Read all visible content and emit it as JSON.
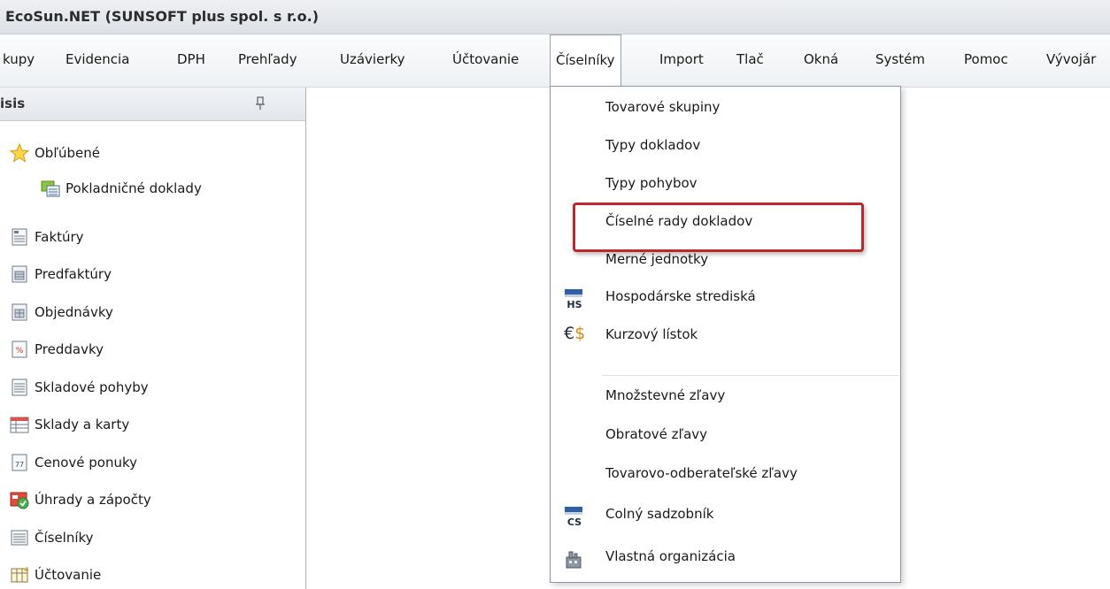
{
  "window": {
    "title": "EcoSun.NET  (SUNSOFT plus spol. s r.o.)"
  },
  "menubar": {
    "items": [
      {
        "label": "kupy",
        "active": false
      },
      {
        "label": "Evidencia",
        "active": false
      },
      {
        "label": "DPH",
        "active": false
      },
      {
        "label": "Prehľady",
        "active": false
      },
      {
        "label": "Uzávierky",
        "active": false
      },
      {
        "label": "Účtovanie",
        "active": false
      },
      {
        "label": "Číselníky",
        "active": true
      },
      {
        "label": "Import",
        "active": false
      },
      {
        "label": "Tlač",
        "active": false
      },
      {
        "label": "Okná",
        "active": false
      },
      {
        "label": "Systém",
        "active": false
      },
      {
        "label": "Pomoc",
        "active": false
      },
      {
        "label": "Vývojár",
        "active": false
      }
    ]
  },
  "panel": {
    "title": "isis",
    "favorites": {
      "label": "Obľúbené",
      "icon": "star-icon"
    },
    "favorite_items": [
      {
        "label": "Pokladničné doklady",
        "icon": "cash-register-icon"
      }
    ],
    "items": [
      {
        "label": "Faktúry",
        "icon": "invoice-icon"
      },
      {
        "label": "Predfaktúry",
        "icon": "proforma-icon"
      },
      {
        "label": "Objednávky",
        "icon": "order-icon"
      },
      {
        "label": "Preddavky",
        "icon": "advance-icon"
      },
      {
        "label": "Skladové pohyby",
        "icon": "stock-movement-icon"
      },
      {
        "label": "Sklady a karty",
        "icon": "warehouse-icon"
      },
      {
        "label": "Cenové ponuky",
        "icon": "quote-icon"
      },
      {
        "label": "Úhrady a zápočty",
        "icon": "payments-icon"
      },
      {
        "label": "Číselníky",
        "icon": "codebook-icon"
      },
      {
        "label": "Účtovanie",
        "icon": "accounting-icon"
      }
    ]
  },
  "dropdown": {
    "items": [
      {
        "label": "Tovarové skupiny",
        "icon": ""
      },
      {
        "label": "Typy dokladov",
        "icon": ""
      },
      {
        "label": "Typy pohybov",
        "icon": ""
      },
      {
        "label": "Číselné rady dokladov",
        "icon": "",
        "highlighted": true
      },
      {
        "label": "Merné jednotky",
        "icon": ""
      },
      {
        "label": "Hospodárske strediská",
        "icon": "hs-icon",
        "icon_text": "HS"
      },
      {
        "label": "Kurzový lístok",
        "icon": "currency-icon",
        "icon_text": "€$"
      },
      {
        "label": "Množstevné zľavy",
        "icon": ""
      },
      {
        "label": "Obratové zľavy",
        "icon": ""
      },
      {
        "label": "Tovarovo-odberateľské zľavy",
        "icon": ""
      },
      {
        "label": "Colný sadzobník",
        "icon": "cs-icon",
        "icon_text": "CS"
      },
      {
        "label": "Vlastná organizácia",
        "icon": "organization-icon"
      }
    ]
  },
  "colors": {
    "highlight": "#c0272d",
    "accent_blue": "#2f5fa8"
  }
}
